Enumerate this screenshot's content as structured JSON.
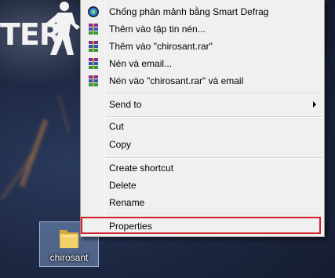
{
  "wallpaper": {
    "logo_text": "TER"
  },
  "desktop": {
    "folder_label": "chirosant"
  },
  "context_menu": {
    "items": [
      {
        "label": "Chống phân mảnh bằng Smart Defrag",
        "icon": "smart-defrag-icon"
      },
      {
        "label": "Thêm vào tập tin nén...",
        "icon": "winrar-icon"
      },
      {
        "label": "Thêm vào \"chirosant.rar\"",
        "icon": "winrar-icon"
      },
      {
        "label": "Nén và email...",
        "icon": "winrar-icon"
      },
      {
        "label": "Nén vào \"chirosant.rar\" và email",
        "icon": "winrar-icon"
      },
      {
        "label": "Send to",
        "has_submenu": true
      },
      {
        "label": "Cut"
      },
      {
        "label": "Copy"
      },
      {
        "label": "Create shortcut"
      },
      {
        "label": "Delete"
      },
      {
        "label": "Rename"
      },
      {
        "label": "Properties",
        "highlighted": true
      }
    ]
  },
  "colors": {
    "menu_bg": "#f0f0f0",
    "highlight_border": "#d0202a",
    "selection": "#8caadc"
  }
}
